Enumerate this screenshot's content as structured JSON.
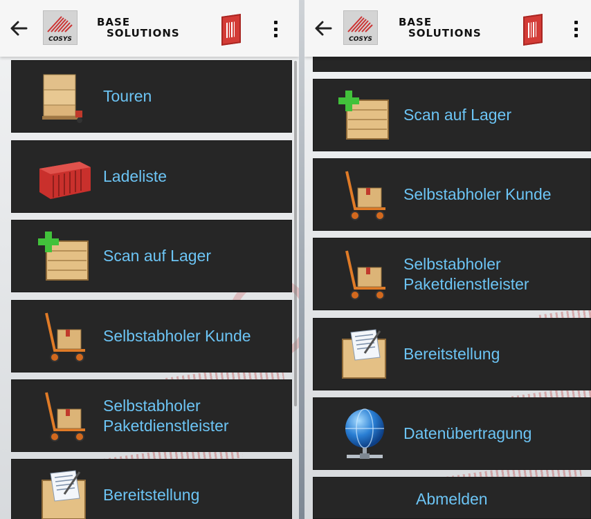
{
  "brand": {
    "line1": "BASE",
    "line2": "SOLUTIONS",
    "logo_text": "COSYS"
  },
  "colors": {
    "tile_background": "#262626",
    "tile_text": "#6cc4f4",
    "appbar_background": "#f6f6f6",
    "barcode_red": "#d33b36"
  },
  "icons": {
    "back": "arrow-left-icon",
    "logo": "cosys-logo",
    "barcode": "barcode-icon",
    "menu": "more-vertical-icon"
  },
  "left_screen": {
    "items": [
      {
        "label": "Touren",
        "icon": "pallet-truck-icon"
      },
      {
        "label": "Ladeliste",
        "icon": "container-icon"
      },
      {
        "label": "Scan auf Lager",
        "icon": "box-add-icon"
      },
      {
        "label": "Selbstabholer Kunde",
        "icon": "hand-truck-icon"
      },
      {
        "label": "Selbstabholer\nPaketdienstleister",
        "icon": "hand-truck-icon"
      },
      {
        "label": "Bereitstellung",
        "icon": "box-document-icon"
      }
    ]
  },
  "right_screen": {
    "items": [
      {
        "label": "Scan auf Lager",
        "icon": "box-add-icon"
      },
      {
        "label": "Selbstabholer Kunde",
        "icon": "hand-truck-icon"
      },
      {
        "label": "Selbstabholer\nPaketdienstleister",
        "icon": "hand-truck-icon"
      },
      {
        "label": "Bereitstellung",
        "icon": "box-document-icon"
      },
      {
        "label": "Datenübertragung",
        "icon": "globe-network-icon"
      },
      {
        "label": "Abmelden",
        "icon": ""
      }
    ]
  }
}
